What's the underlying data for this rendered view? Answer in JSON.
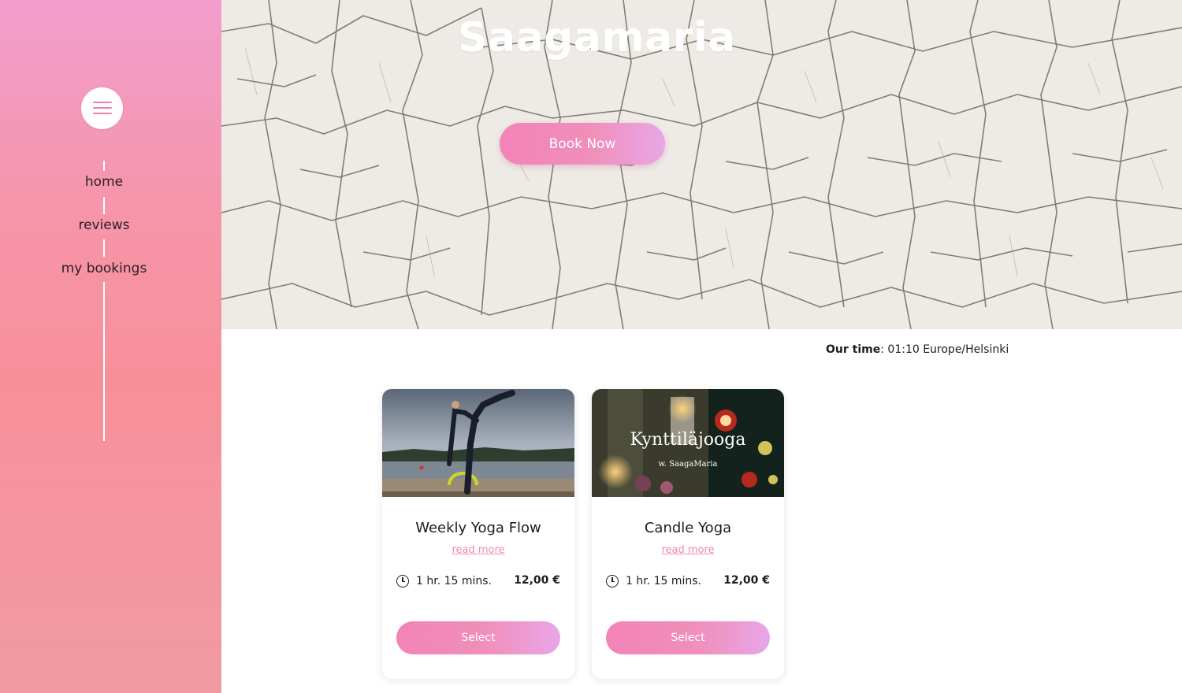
{
  "sidebar": {
    "menu_icon": "hamburger-icon",
    "nav": [
      {
        "label": "home"
      },
      {
        "label": "reviews"
      },
      {
        "label": "my bookings"
      }
    ]
  },
  "hero": {
    "title": "Saagamaria",
    "book_button": "Book Now"
  },
  "time": {
    "label": "Our time",
    "separator": ":",
    "value": "01:10 Europe/Helsinki"
  },
  "services": [
    {
      "title": "Weekly Yoga Flow",
      "read_more": "read more",
      "duration": "1 hr. 15 mins.",
      "price": "12,00 €",
      "select": "Select",
      "image": "yoga-pose-by-lake-photo"
    },
    {
      "title": "Candle Yoga",
      "read_more": "read more",
      "duration": "1 hr. 15 mins.",
      "price": "12,00 €",
      "select": "Select",
      "image": "candles-photo",
      "image_text": "Kynttiläjooga",
      "image_subtext": "w. SaagaMaria"
    }
  ],
  "colors": {
    "accent_pink": "#f283b6",
    "accent_lilac": "#e8a6e7",
    "link_pink": "#ef8aa6"
  }
}
